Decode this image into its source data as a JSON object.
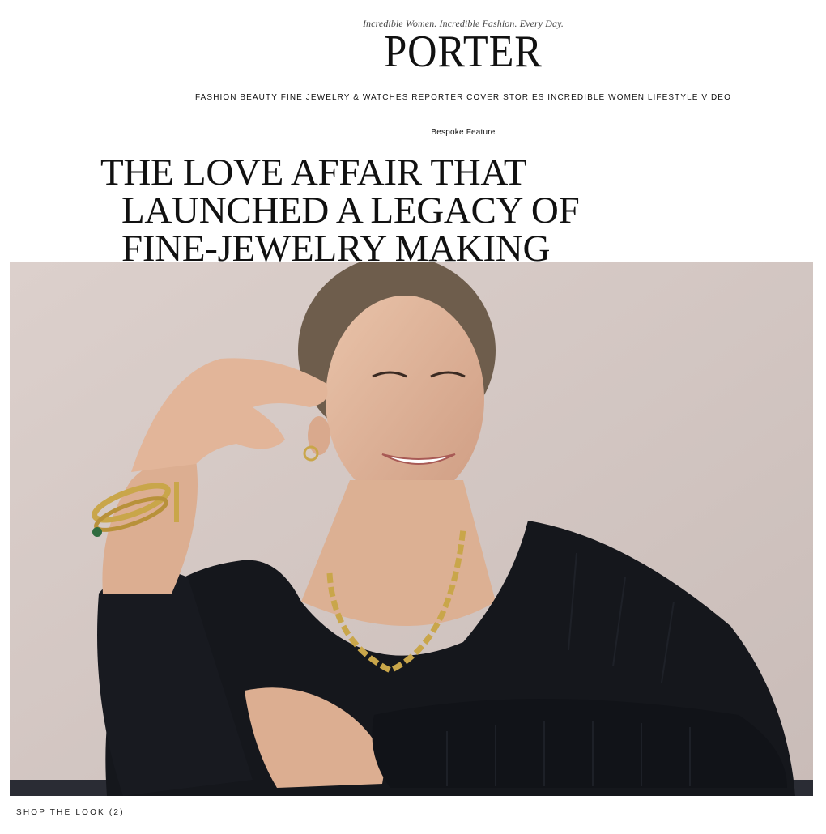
{
  "header": {
    "tagline": "Incredible Women. Incredible Fashion. Every Day.",
    "logo": "PORTER"
  },
  "nav": {
    "items": [
      {
        "label": "FASHION"
      },
      {
        "label": "BEAUTY"
      },
      {
        "label": "FINE JEWELRY & WATCHES"
      },
      {
        "label": "REPORTER"
      },
      {
        "label": "COVER STORIES"
      },
      {
        "label": "INCREDIBLE WOMEN"
      },
      {
        "label": "LIFESTYLE"
      },
      {
        "label": "VIDEO"
      }
    ]
  },
  "article": {
    "kicker": "Bespoke Feature",
    "headline_lines": [
      "THE LOVE AFFAIR THAT",
      "LAUNCHED A LEGACY OF",
      "FINE-JEWELRY MAKING"
    ]
  },
  "shop": {
    "label": "SHOP THE LOOK (2)"
  },
  "colors": {
    "background": "#ffffff",
    "text": "#111111",
    "hero_backdrop": "#d7cbc7",
    "sweater": "#15171c",
    "gold": "#c9a64a"
  }
}
